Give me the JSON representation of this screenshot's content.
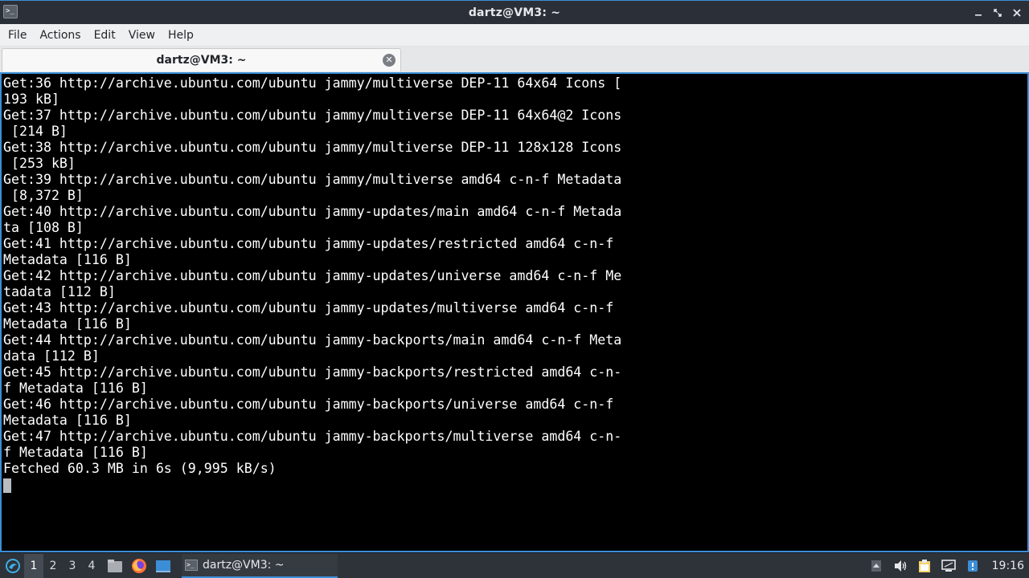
{
  "window": {
    "title": "dartz@VM3: ~",
    "controls": [
      "minimize",
      "maximize",
      "close"
    ]
  },
  "menu": {
    "items": [
      "File",
      "Actions",
      "Edit",
      "View",
      "Help"
    ]
  },
  "tabs": [
    {
      "label": "dartz@VM3: ~",
      "active": true
    }
  ],
  "terminal": {
    "lines": [
      "Get:36 http://archive.ubuntu.com/ubuntu jammy/multiverse DEP-11 64x64 Icons [",
      "193 kB]",
      "Get:37 http://archive.ubuntu.com/ubuntu jammy/multiverse DEP-11 64x64@2 Icons",
      " [214 B]",
      "Get:38 http://archive.ubuntu.com/ubuntu jammy/multiverse DEP-11 128x128 Icons",
      " [253 kB]",
      "Get:39 http://archive.ubuntu.com/ubuntu jammy/multiverse amd64 c-n-f Metadata",
      " [8,372 B]",
      "Get:40 http://archive.ubuntu.com/ubuntu jammy-updates/main amd64 c-n-f Metada",
      "ta [108 B]",
      "Get:41 http://archive.ubuntu.com/ubuntu jammy-updates/restricted amd64 c-n-f",
      "Metadata [116 B]",
      "Get:42 http://archive.ubuntu.com/ubuntu jammy-updates/universe amd64 c-n-f Me",
      "tadata [112 B]",
      "Get:43 http://archive.ubuntu.com/ubuntu jammy-updates/multiverse amd64 c-n-f",
      "Metadata [116 B]",
      "Get:44 http://archive.ubuntu.com/ubuntu jammy-backports/main amd64 c-n-f Meta",
      "data [112 B]",
      "Get:45 http://archive.ubuntu.com/ubuntu jammy-backports/restricted amd64 c-n-",
      "f Metadata [116 B]",
      "Get:46 http://archive.ubuntu.com/ubuntu jammy-backports/universe amd64 c-n-f",
      "Metadata [116 B]",
      "Get:47 http://archive.ubuntu.com/ubuntu jammy-backports/multiverse amd64 c-n-",
      "f Metadata [116 B]",
      "Fetched 60.3 MB in 6s (9,995 kB/s)"
    ]
  },
  "taskbar": {
    "workspaces": [
      "1",
      "2",
      "3",
      "4"
    ],
    "active_workspace": "1",
    "launchers": [
      "file-manager-icon",
      "firefox-icon",
      "desktop-icon"
    ],
    "task_label": "dartz@VM3: ~",
    "clock": "19:16"
  },
  "colors": {
    "accent": "#3b8ed6",
    "terminal_bg": "#000000",
    "terminal_fg": "#ffffff"
  }
}
